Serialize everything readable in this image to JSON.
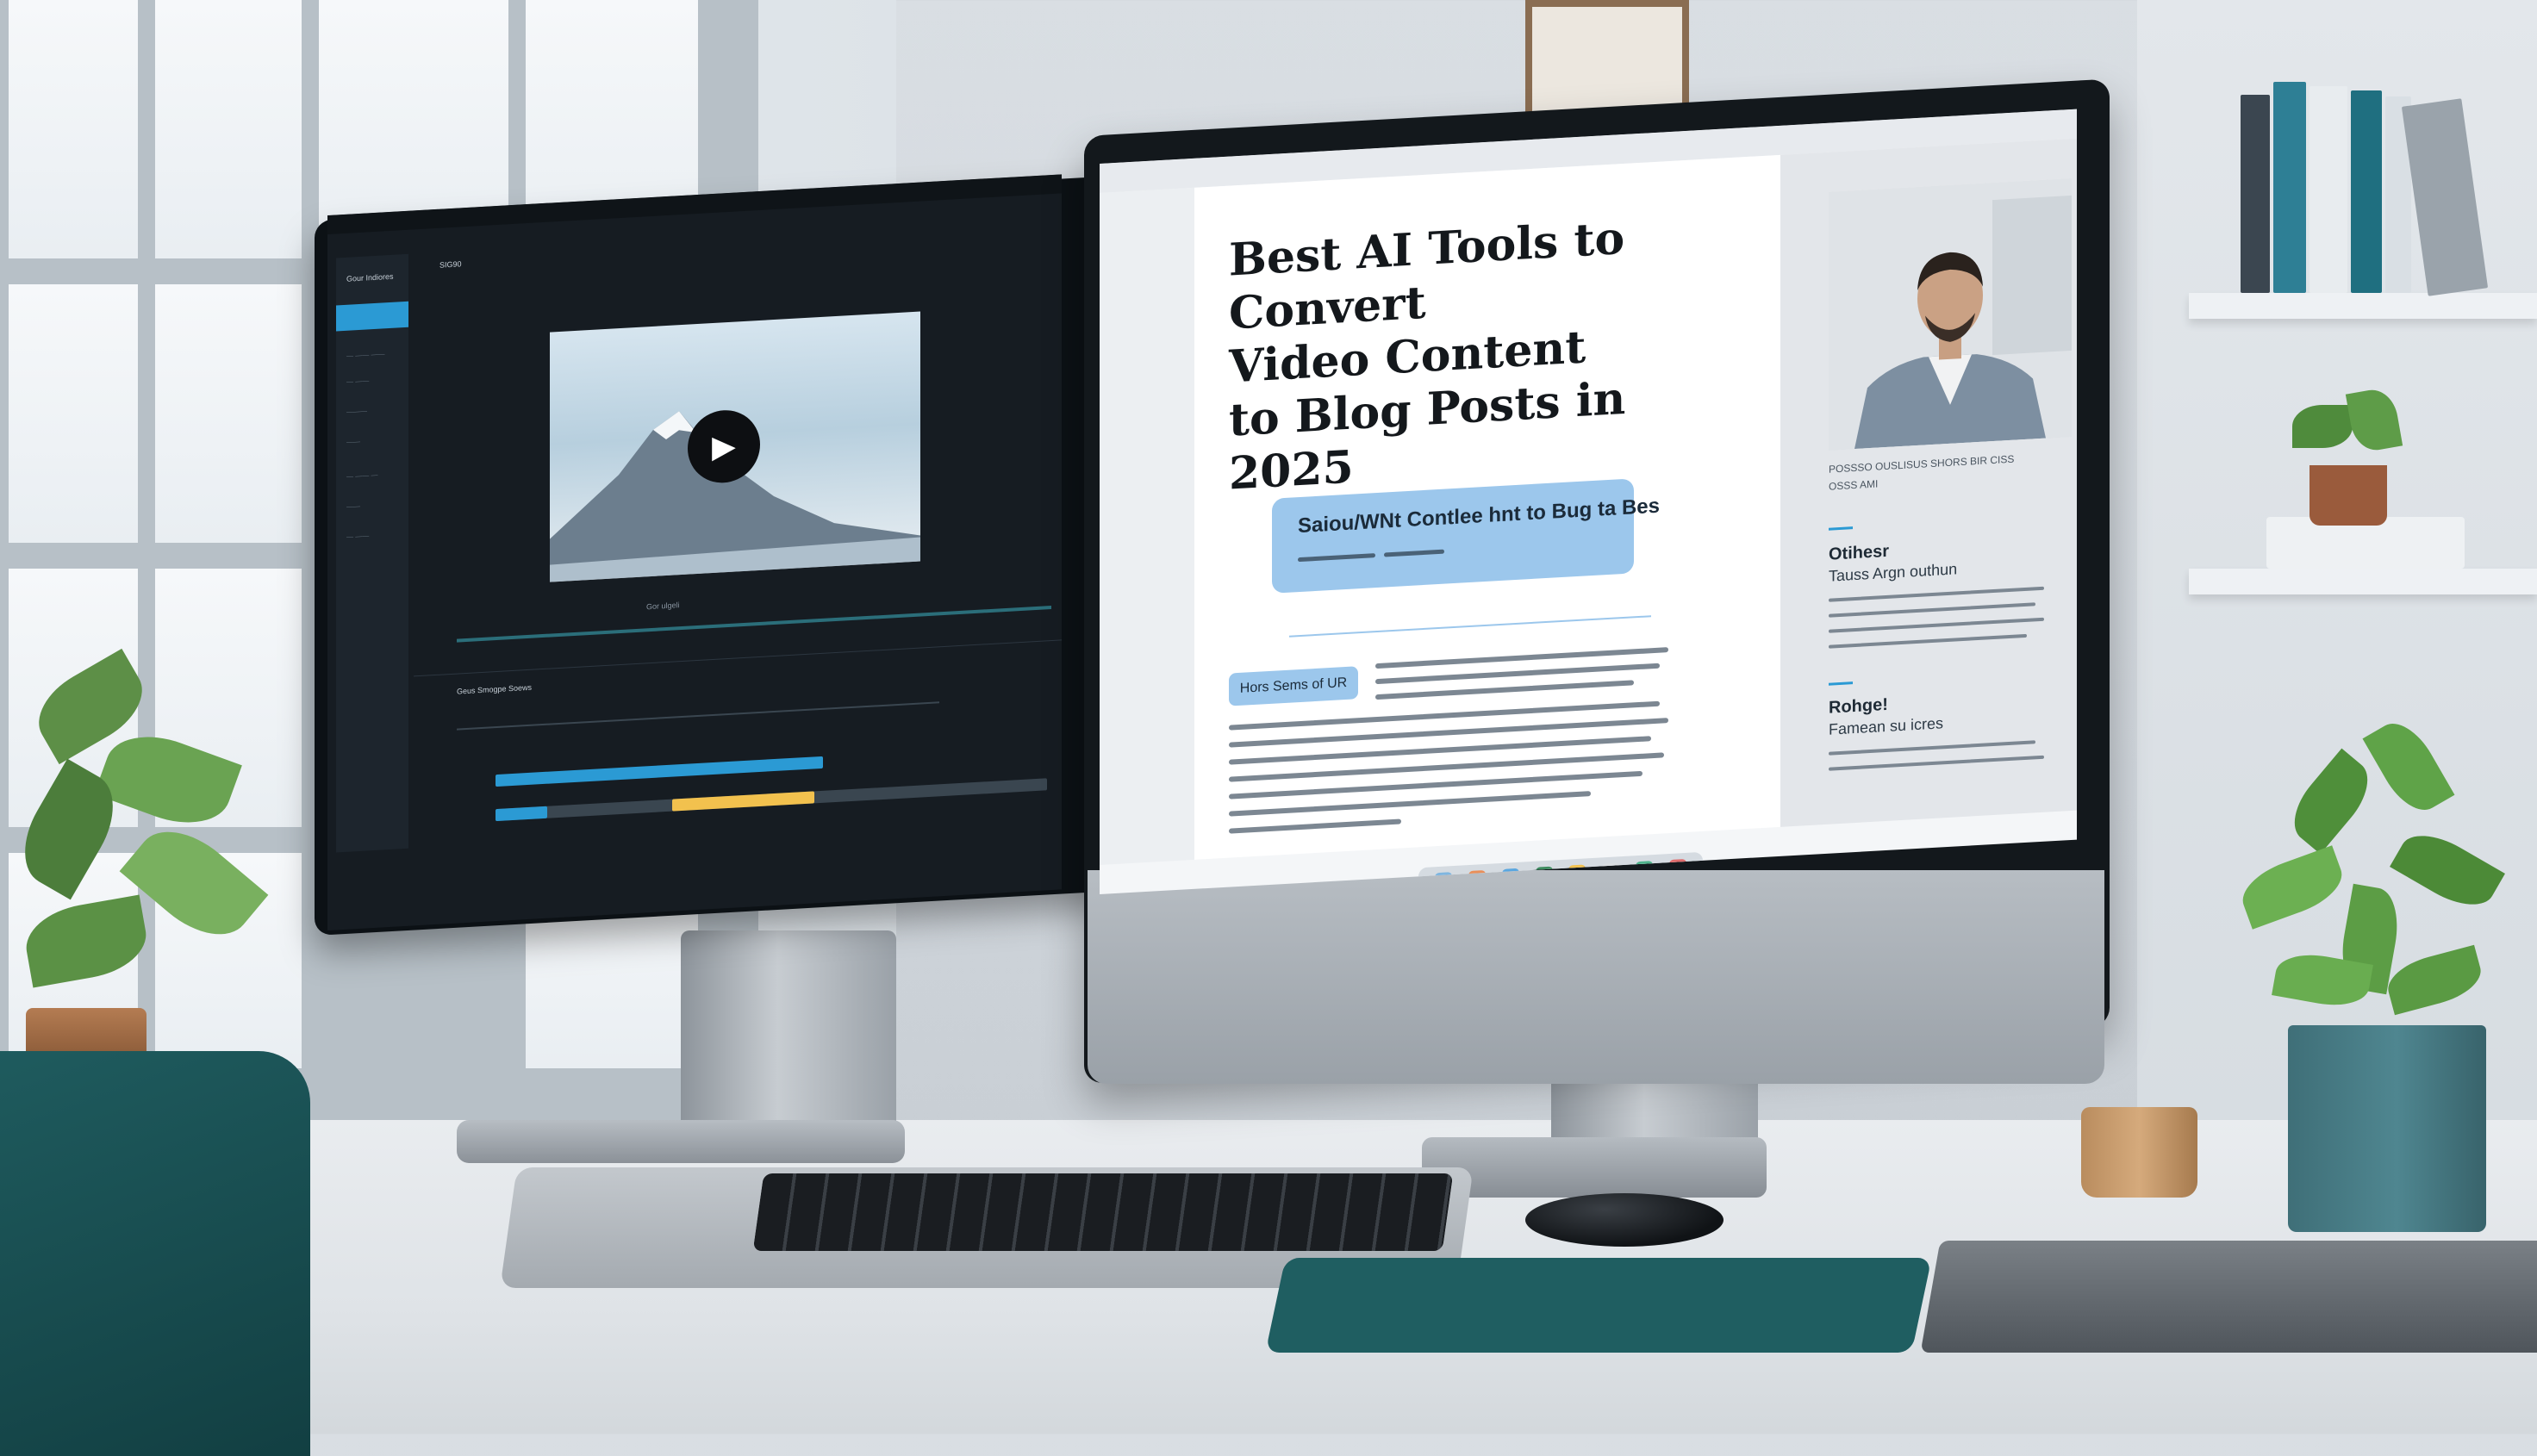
{
  "blog": {
    "headline": "Best AI Tools to Convert Video Content to Blog Posts in 2025",
    "headline_lines": [
      "Best AI Tools to Convert",
      "Video Content",
      "to Blog Posts in 2025"
    ],
    "callout_label": "Saiou/WNt Contlee hnt to Bug ta Bes",
    "pill_label": "Hors Sems of UR",
    "author_caption": "POSSSO OUSLISUS SHORS BIR CISS",
    "author_subcaption": "OSSS AMI",
    "sidebar_sections": [
      {
        "title": "Otihesr",
        "subtitle": "Tauss Argn outhun"
      },
      {
        "title": "Rohge!",
        "subtitle": "Famean su icres"
      }
    ]
  },
  "editor": {
    "sidebar_title": "Gour Indiores",
    "tab_label": "SIG90",
    "time_label": "Gor ulgeli",
    "panel_title": "Geus Smogpe Soews"
  },
  "colors": {
    "accent_blue": "#2b9ad4",
    "callout_blue": "#9cc7ec",
    "track_yellow": "#f2c14e",
    "teal": "#1f5e61"
  },
  "icons": [
    "play-icon"
  ]
}
